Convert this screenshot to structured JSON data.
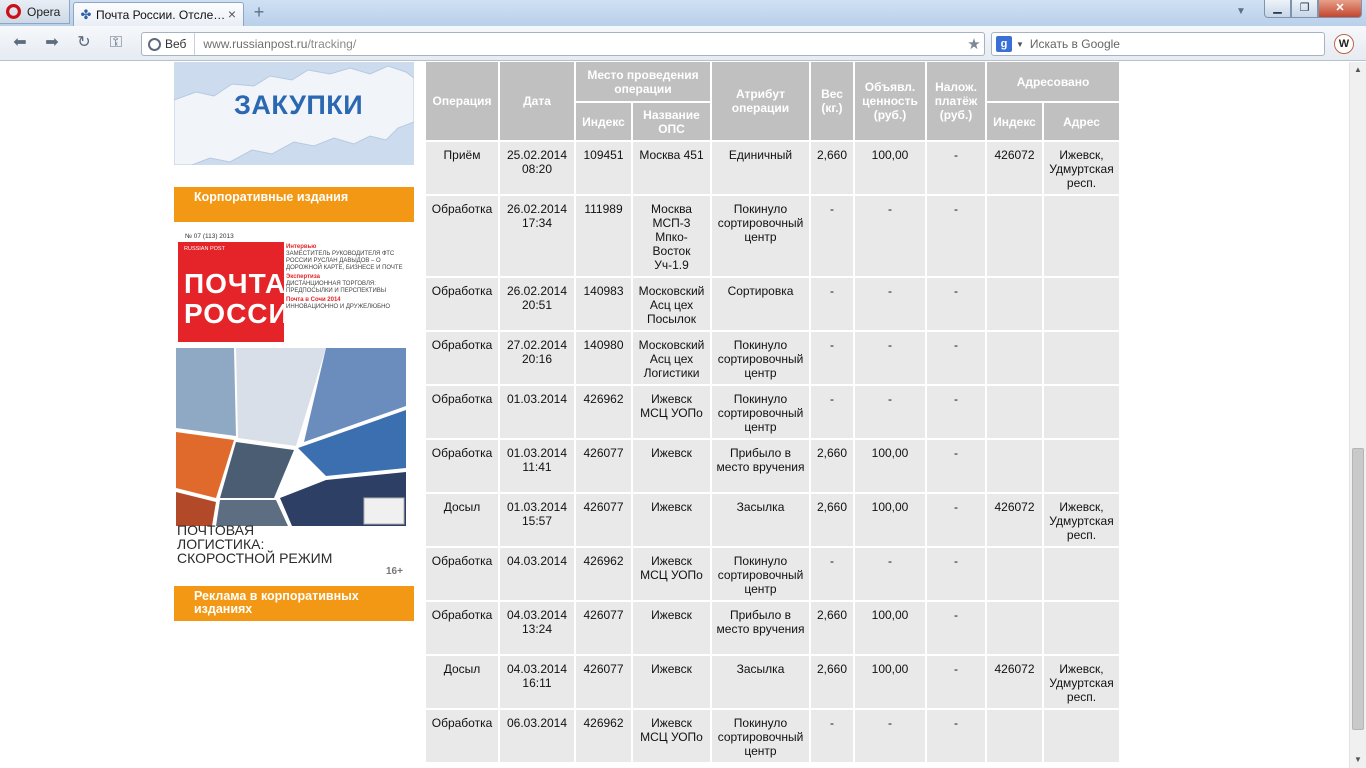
{
  "browser": {
    "menu_label": "Opera",
    "tab_title": "Почта России. Отсле…",
    "url_host": "www.russianpost.ru",
    "url_path": "/tracking/",
    "web_chip": "Веб",
    "search_placeholder": "Искать в Google",
    "search_engine_icon": "g-icon",
    "extension_icon_label": "W"
  },
  "sidebar": {
    "map_banner_label": "ЗАКУПКИ",
    "corporate_title": "Корпоративные издания",
    "advert_title": "Реклама в корпоративных изданиях",
    "magazine": {
      "issue": "№ 07 (113) 2013",
      "brand_small": "RUSSIAN POST",
      "logo_line1": "ПОЧТА",
      "logo_line2": "РОССИИ",
      "notes": [
        {
          "head": "Интервью",
          "text": "ЗАМЕСТИТЕЛЬ РУКОВОДИТЕЛЯ ФТС РОССИИ РУСЛАН ДАВЫДОВ – О ДОРОЖНОЙ КАРТЕ, БИЗНЕСЕ И ПОЧТЕ"
        },
        {
          "head": "Экспертиза",
          "text": "ДИСТАНЦИОННАЯ ТОРГОВЛЯ: ПРЕДПОСЫЛКИ И ПЕРСПЕКТИВЫ"
        },
        {
          "head": "Почта в Сочи 2014",
          "text": "ИННОВАЦИОННО И ДРУЖЕЛЮБНО"
        }
      ],
      "headline_1": "ПОЧТОВАЯ",
      "headline_2": "ЛОГИСТИКА:",
      "headline_3": "СКОРОСТНОЙ РЕЖИМ",
      "age_rating": "16+"
    }
  },
  "tracking": {
    "headers": {
      "operation": "Операция",
      "date": "Дата",
      "place_group": "Место проведения операции",
      "index": "Индекс",
      "ops_name": "Название ОПС",
      "attribute": "Атрибут операции",
      "weight": "Вес (кг.)",
      "declared_value": "Объявл. ценность (руб.)",
      "cod": "Налож. платёж (руб.)",
      "addressed_group": "Адресовано",
      "addr_index": "Индекс",
      "address": "Адрес"
    },
    "rows": [
      {
        "op": "Приём",
        "date": "25.02.2014 08:20",
        "index": "109451",
        "name": "Москва 451",
        "attr": "Единичный",
        "weight": "2,660",
        "value": "100,00",
        "cod": "-",
        "to_index": "426072",
        "to_addr": "Ижевск, Удмуртская респ."
      },
      {
        "op": "Обработка",
        "date": "26.02.2014 17:34",
        "index": "111989",
        "name": "Москва МСП-3 Мпко-Восток Уч-1.9",
        "attr": "Покинуло сортировочный центр",
        "weight": "-",
        "value": "-",
        "cod": "-",
        "to_index": "",
        "to_addr": ""
      },
      {
        "op": "Обработка",
        "date": "26.02.2014 20:51",
        "index": "140983",
        "name": "Московский Асц цех Посылок",
        "attr": "Сортировка",
        "weight": "-",
        "value": "-",
        "cod": "-",
        "to_index": "",
        "to_addr": ""
      },
      {
        "op": "Обработка",
        "date": "27.02.2014 20:16",
        "index": "140980",
        "name": "Московский Асц цех Логистики",
        "attr": "Покинуло сортировочный центр",
        "weight": "-",
        "value": "-",
        "cod": "-",
        "to_index": "",
        "to_addr": ""
      },
      {
        "op": "Обработка",
        "date": "01.03.2014",
        "index": "426962",
        "name": "Ижевск МСЦ УОПо",
        "attr": "Покинуло сортировочный центр",
        "weight": "-",
        "value": "-",
        "cod": "-",
        "to_index": "",
        "to_addr": ""
      },
      {
        "op": "Обработка",
        "date": "01.03.2014 11:41",
        "index": "426077",
        "name": "Ижевск",
        "attr": "Прибыло в место вручения",
        "weight": "2,660",
        "value": "100,00",
        "cod": "-",
        "to_index": "",
        "to_addr": ""
      },
      {
        "op": "Досыл",
        "date": "01.03.2014 15:57",
        "index": "426077",
        "name": "Ижевск",
        "attr": "Засылка",
        "weight": "2,660",
        "value": "100,00",
        "cod": "-",
        "to_index": "426072",
        "to_addr": "Ижевск, Удмуртская респ."
      },
      {
        "op": "Обработка",
        "date": "04.03.2014",
        "index": "426962",
        "name": "Ижевск МСЦ УОПо",
        "attr": "Покинуло сортировочный центр",
        "weight": "-",
        "value": "-",
        "cod": "-",
        "to_index": "",
        "to_addr": ""
      },
      {
        "op": "Обработка",
        "date": "04.03.2014 13:24",
        "index": "426077",
        "name": "Ижевск",
        "attr": "Прибыло в место вручения",
        "weight": "2,660",
        "value": "100,00",
        "cod": "-",
        "to_index": "",
        "to_addr": ""
      },
      {
        "op": "Досыл",
        "date": "04.03.2014 16:11",
        "index": "426077",
        "name": "Ижевск",
        "attr": "Засылка",
        "weight": "2,660",
        "value": "100,00",
        "cod": "-",
        "to_index": "426072",
        "to_addr": "Ижевск, Удмуртская респ."
      },
      {
        "op": "Обработка",
        "date": "06.03.2014",
        "index": "426962",
        "name": "Ижевск МСЦ УОПо",
        "attr": "Покинуло сортировочный центр",
        "weight": "-",
        "value": "-",
        "cod": "-",
        "to_index": "",
        "to_addr": ""
      }
    ]
  },
  "colors": {
    "header_bg": "#c0c0c0",
    "cell_bg": "#e9e9e9",
    "accent_orange": "#f39814",
    "brand_red": "#e42428",
    "map_blue": "#2a68b2"
  }
}
